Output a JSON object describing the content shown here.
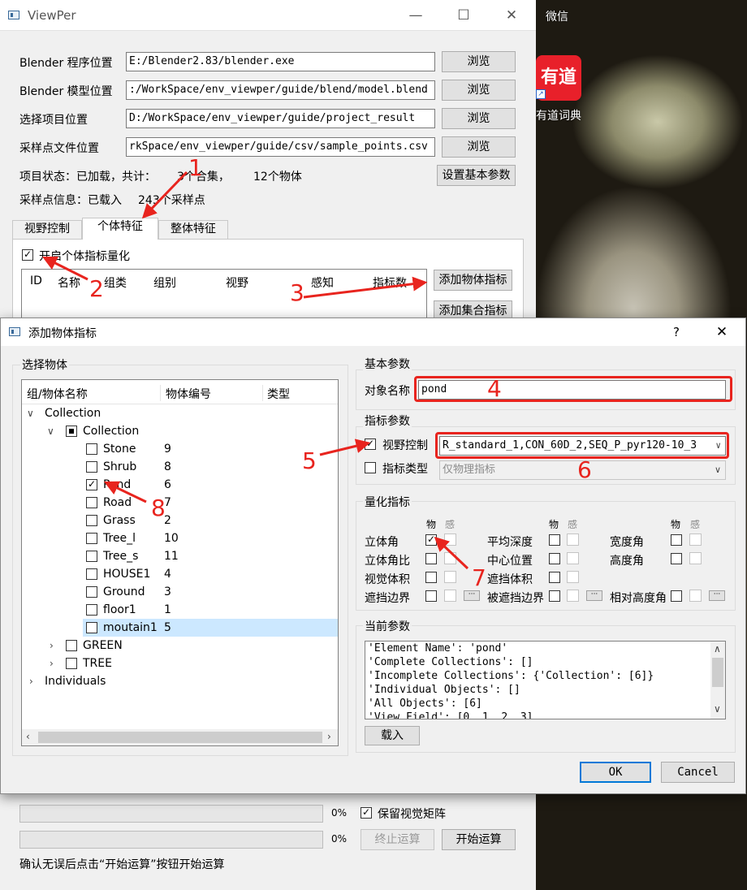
{
  "desktop": {
    "wechat": "微信",
    "youdao_logo": "有道",
    "youdao_label": "有道词典"
  },
  "main": {
    "title": "ViewPer",
    "win_min": "—",
    "win_max": "☐",
    "win_close": "✕",
    "rows": [
      {
        "label": "Blender 程序位置",
        "value": "E:/Blender2.83/blender.exe",
        "button": "浏览"
      },
      {
        "label": "Blender 模型位置",
        "value": ":/WorkSpace/env_viewper/guide/blend/model.blend",
        "button": "浏览"
      },
      {
        "label": "选择项目位置",
        "value": "D:/WorkSpace/env_viewper/guide/project_result",
        "button": "浏览"
      },
      {
        "label": "采样点文件位置",
        "value": "rkSpace/env_viewper/guide/csv/sample_points.csv",
        "button": "浏览"
      }
    ],
    "status_prefix": "项目状态：已加载，共计：",
    "status_sets": "3个合集，",
    "status_objects": "12个物体",
    "set_params_button": "设置基本参数",
    "sample_info": "采样点信息：已载入",
    "sample_count": "243个采样点",
    "tabs": [
      "视野控制",
      "个体特征",
      "整体特征"
    ],
    "enable_label": "开启个体指标量化",
    "table_headers": [
      "ID",
      "名称",
      "组类",
      "组别",
      "视野",
      "感知",
      "指标数"
    ],
    "add_object_indicator": "添加物体指标",
    "add_set_indicator": "添加集合指标",
    "progress1_pct": "0%",
    "progress2_pct": "0%",
    "progress1_fraction": 0,
    "progress2_fraction": 0,
    "keep_matrix_label": "保留视觉矩阵",
    "stop_button": "终止运算",
    "start_button": "开始运算",
    "footer_hint": "确认无误后点击“开始运算”按钮开始运算"
  },
  "dialog": {
    "title": "添加物体指标",
    "help": "?",
    "close": "✕",
    "select_group": "选择物体",
    "tree_headers": [
      "组/物体名称",
      "物体编号",
      "类型"
    ],
    "tree": [
      {
        "label": "Collection",
        "level": 0,
        "expander": "﹀"
      },
      {
        "label": "Collection",
        "level": 1,
        "expander": "﹀",
        "check": "partial"
      },
      {
        "label": "Stone",
        "id": "9",
        "level": 2,
        "check": "off"
      },
      {
        "label": "Shrub",
        "id": "8",
        "level": 2,
        "check": "off"
      },
      {
        "label": "Pond",
        "id": "6",
        "level": 2,
        "check": "on"
      },
      {
        "label": "Road",
        "id": "7",
        "level": 2,
        "check": "off"
      },
      {
        "label": "Grass",
        "id": "2",
        "level": 2,
        "check": "off"
      },
      {
        "label": "Tree_l",
        "id": "10",
        "level": 2,
        "check": "off"
      },
      {
        "label": "Tree_s",
        "id": "11",
        "level": 2,
        "check": "off"
      },
      {
        "label": "HOUSE1",
        "id": "4",
        "level": 2,
        "check": "off"
      },
      {
        "label": "Ground",
        "id": "3",
        "level": 2,
        "check": "off"
      },
      {
        "label": "floor1",
        "id": "1",
        "level": 2,
        "check": "off"
      },
      {
        "label": "moutain1",
        "id": "5",
        "level": 2,
        "check": "off",
        "selected": true
      },
      {
        "label": "GREEN",
        "level": 1,
        "expander": "›",
        "check": "off"
      },
      {
        "label": "TREE",
        "level": 1,
        "expander": "›",
        "check": "off"
      },
      {
        "label": "Individuals",
        "level": 0,
        "expander": "›"
      }
    ],
    "basic_group": "基本参数",
    "object_name_label": "对象名称",
    "object_name_value": "pond",
    "indicator_group": "指标参数",
    "view_control_label": "视野控制",
    "view_control_value": "R_standard_1,CON_60D_2,SEQ_P_pyr120-10_3",
    "indicator_type_label": "指标类型",
    "indicator_type_value": "仅物理指标",
    "quant_group": "量化指标",
    "col_phys": "物",
    "col_perc": "感",
    "metrics_col1": [
      "立体角",
      "立体角比",
      "视觉体积",
      "遮挡边界"
    ],
    "metrics_col2": [
      "平均深度",
      "中心位置",
      "遮挡体积",
      "被遮挡边界"
    ],
    "metrics_col3": [
      "宽度角",
      "高度角",
      "相对高度角"
    ],
    "ellipsis": "···",
    "current_group": "当前参数",
    "current_lines": [
      "'Element Name': 'pond'",
      "'Complete Collections': []",
      "'Incomplete Collections': {'Collection': [6]}",
      "'Individual Objects': []",
      "'All Objects': [6]",
      "'View Field': [0, 1, 2, 3]"
    ],
    "load_button": "载入",
    "ok_button": "OK",
    "cancel_button": "Cancel"
  },
  "annotations": [
    "1",
    "2",
    "3",
    "4",
    "5",
    "6",
    "7",
    "8"
  ],
  "colors": {
    "annotation_red": "#e8241e",
    "selection": "#cce8ff"
  }
}
